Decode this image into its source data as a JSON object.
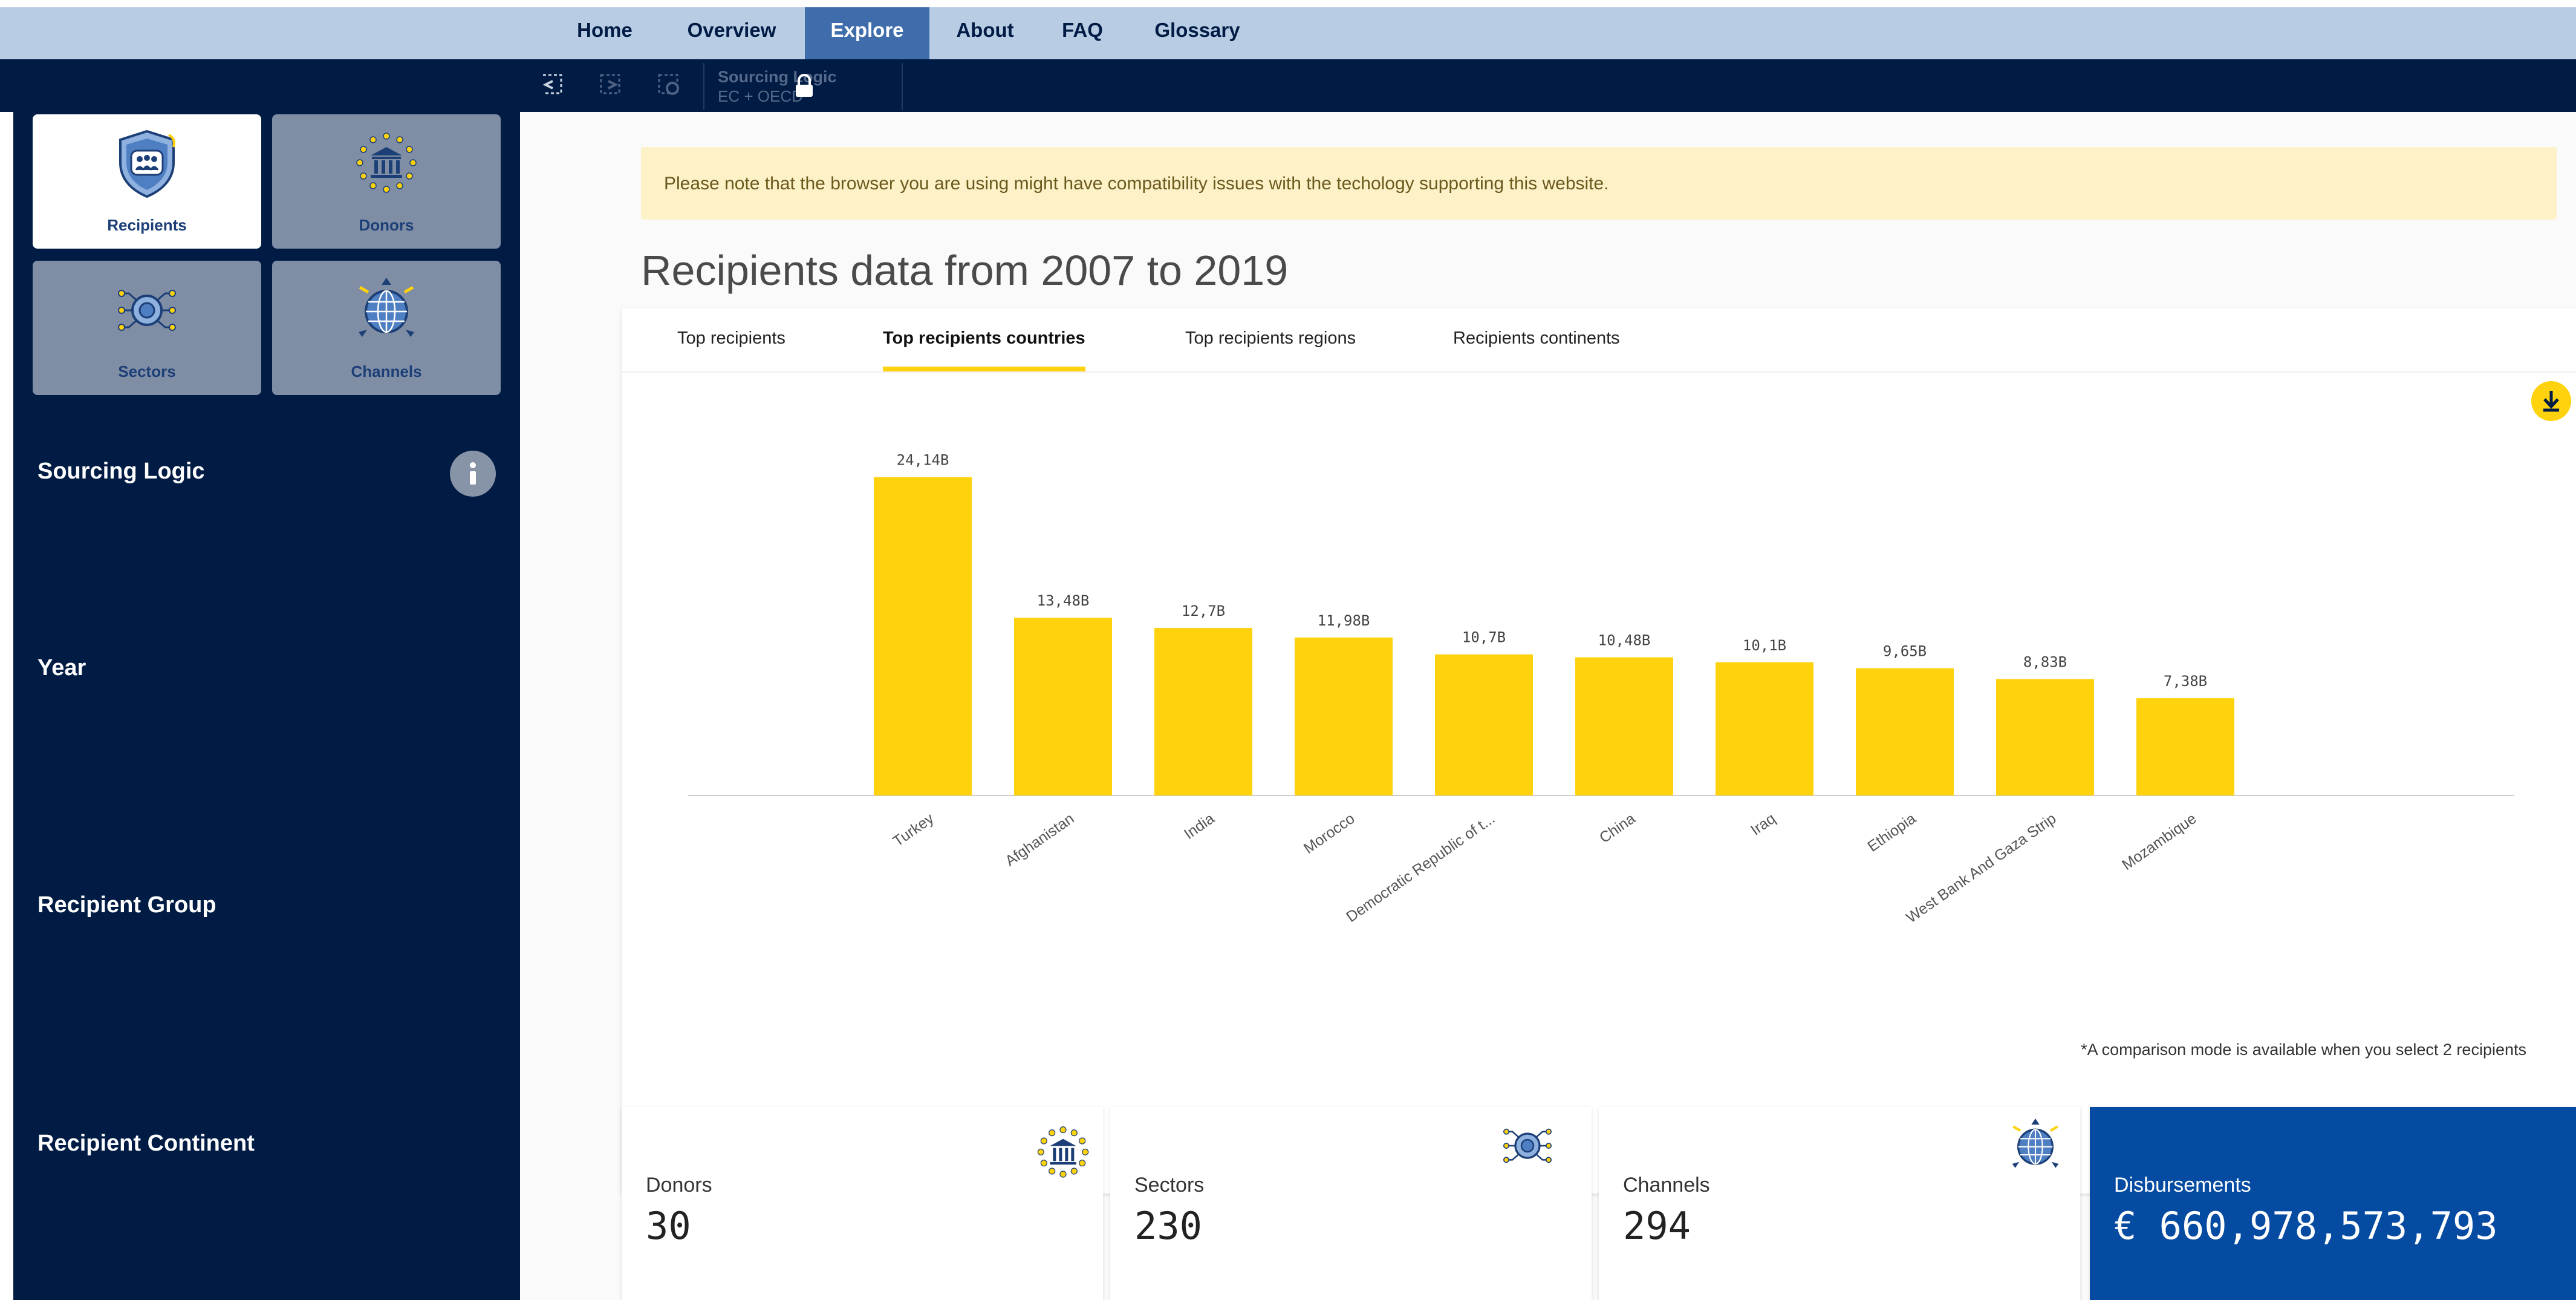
{
  "topnav": {
    "items": [
      {
        "label": "Home"
      },
      {
        "label": "Overview"
      },
      {
        "label": "Explore"
      },
      {
        "label": "About"
      },
      {
        "label": "FAQ"
      },
      {
        "label": "Glossary"
      }
    ],
    "active": "Explore"
  },
  "toolbar": {
    "sourcing_title": "Sourcing Logic",
    "sourcing_value": "EC + OECD"
  },
  "sidebar": {
    "tiles": [
      {
        "label": "Recipients",
        "icon": "recipients-shield-icon",
        "active": true
      },
      {
        "label": "Donors",
        "icon": "donors-bank-icon",
        "active": false
      },
      {
        "label": "Sectors",
        "icon": "sectors-network-icon",
        "active": false
      },
      {
        "label": "Channels",
        "icon": "channels-globe-icon",
        "active": false
      }
    ],
    "filters": [
      {
        "label": "Sourcing Logic"
      },
      {
        "label": "Year"
      },
      {
        "label": "Recipient Group"
      },
      {
        "label": "Recipient Continent"
      }
    ]
  },
  "main": {
    "alert": "Please note that the browser you are using might have compatibility issues with the techology supporting this website.",
    "title": "Recipients data from 2007 to 2019",
    "tabs": [
      {
        "label": "Top recipients"
      },
      {
        "label": "Top recipients countries"
      },
      {
        "label": "Top recipients regions"
      },
      {
        "label": "Recipients continents"
      }
    ],
    "active_tab": "Top recipients countries",
    "footnote": "*A comparison mode is available when you select 2 recipients"
  },
  "chart_data": {
    "type": "bar",
    "categories": [
      "Turkey",
      "Afghanistan",
      "India",
      "Morocco",
      "Democratic Republic of t...",
      "China",
      "Iraq",
      "Ethiopia",
      "West Bank And Gaza Strip",
      "Mozambique"
    ],
    "values": [
      24.14,
      13.48,
      12.7,
      11.98,
      10.7,
      10.48,
      10.1,
      9.65,
      8.83,
      7.38
    ],
    "data_labels": [
      "24,14B",
      "13,48B",
      "12,7B",
      "11,98B",
      "10,7B",
      "10,48B",
      "10,1B",
      "9,65B",
      "8,83B",
      "7,38B"
    ],
    "unit": "B",
    "ylim": [
      0,
      25
    ],
    "bar_color": "#fed20c",
    "grid": false,
    "legend": "none"
  },
  "stats": [
    {
      "label": "Donors",
      "value": "30",
      "icon": "donors-bank-icon"
    },
    {
      "label": "Sectors",
      "value": "230",
      "icon": "sectors-network-icon"
    },
    {
      "label": "Channels",
      "value": "294",
      "icon": "channels-globe-icon"
    },
    {
      "label": "Disbursements",
      "value": "€ 660,978,573,793"
    }
  ],
  "colors": {
    "navy": "#001b44",
    "accent_blue": "#3f6dac",
    "dark_blue_card": "#044ba1",
    "yellow": "#fed20c"
  }
}
